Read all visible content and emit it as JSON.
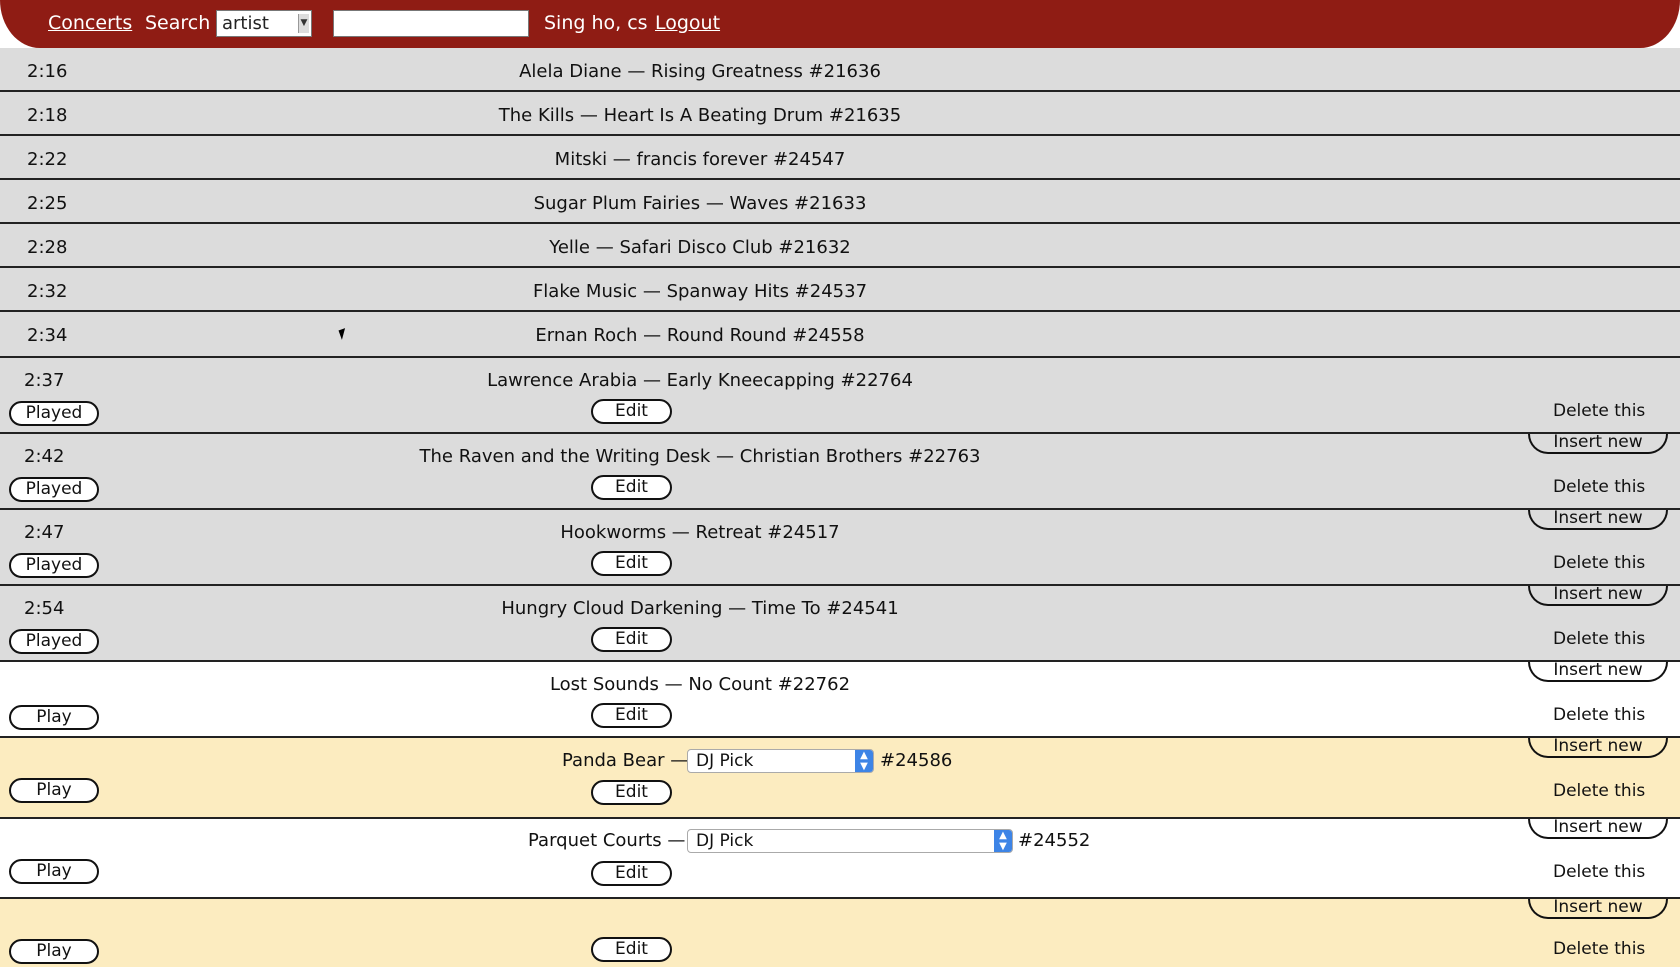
{
  "header": {
    "concerts": "Concerts",
    "search_label": "Search",
    "search_type": "artist",
    "search_value": "",
    "user": "Sing ho, cs",
    "logout": "Logout"
  },
  "played_rows": [
    {
      "time": "2:16",
      "song": "Alela Diane — Rising Greatness #21636"
    },
    {
      "time": "2:18",
      "song": "The Kills — Heart Is A Beating Drum #21635"
    },
    {
      "time": "2:22",
      "song": "Mitski — francis forever #24547"
    },
    {
      "time": "2:25",
      "song": "Sugar Plum Fairies — Waves #21633"
    },
    {
      "time": "2:28",
      "song": "Yelle — Safari Disco Club #21632"
    },
    {
      "time": "2:32",
      "song": "Flake Music — Spanway Hits #24537"
    },
    {
      "time": "2:34",
      "song": "Ernan Roch — Round Round #24558"
    }
  ],
  "editable_rows": [
    {
      "time": "2:37",
      "song": "Lawrence Arabia — Early Kneecapping #22764",
      "status": "Played"
    },
    {
      "time": "2:42",
      "song": "The Raven and the Writing Desk — Christian Brothers #22763",
      "status": "Played"
    },
    {
      "time": "2:47",
      "song": "Hookworms — Retreat #24517",
      "status": "Played"
    },
    {
      "time": "2:54",
      "song": "Hungry Cloud Darkening — Time To #24541",
      "status": "Played"
    },
    {
      "time": "",
      "song": "Lost Sounds — No Count #22762",
      "status": "Play"
    }
  ],
  "pick_rows": [
    {
      "artist": "Panda Bear —",
      "pick": "DJ Pick",
      "id": "#24586",
      "status": "Play"
    },
    {
      "artist": "Parquet Courts —",
      "pick": "DJ Pick",
      "id": "#24552",
      "status": "Play"
    }
  ],
  "last_row": {
    "status": "Play"
  },
  "actions": {
    "edit": "Edit",
    "delete": "Delete this",
    "insert": "Insert new"
  }
}
